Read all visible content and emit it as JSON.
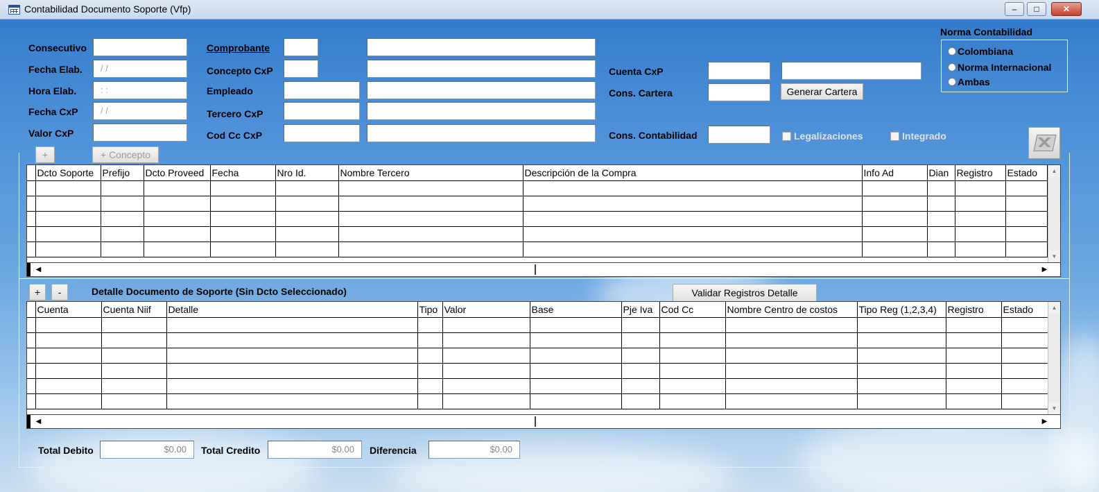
{
  "window": {
    "title": "Contabilidad Documento Soporte (Vfp)",
    "min_label": "–",
    "max_label": "□",
    "close_label": "✕"
  },
  "form": {
    "consecutivo_label": "Consecutivo",
    "fecha_elab_label": "Fecha Elab.",
    "fecha_elab_value": " / /",
    "hora_elab_label": "Hora Elab.",
    "hora_elab_value": " : :",
    "fecha_cxp_label": "Fecha CxP",
    "fecha_cxp_value": " / /",
    "valor_cxp_label": "Valor CxP",
    "comprobante_label": "Comprobante",
    "concepto_cxp_label": "Concepto CxP",
    "empleado_label": "Empleado",
    "tercero_cxp_label": "Tercero CxP",
    "cod_cc_cxp_label": "Cod Cc CxP",
    "cuenta_cxp_label": "Cuenta CxP",
    "cons_cartera_label": "Cons. Cartera",
    "generar_cartera_label": "Generar Cartera",
    "cons_contabilidad_label": "Cons. Contabilidad",
    "legalizaciones_label": "Legalizaciones",
    "integrado_label": "Integrado",
    "add_label": "+",
    "add_concepto_label": "+ Concepto"
  },
  "norma": {
    "title": "Norma Contabilidad",
    "options": [
      "Colombiana",
      "Norma Internacional",
      "Ambas"
    ]
  },
  "grid1": {
    "columns": [
      "Dcto Soporte",
      "Prefijo",
      "Dcto Proveed",
      "Fecha",
      "Nro Id.",
      "Nombre Tercero",
      "Descripción de la Compra",
      "Info Ad",
      "Dian",
      "Registro",
      "Estado"
    ]
  },
  "detail": {
    "add_label": "+",
    "remove_label": "-",
    "title": "Detalle Documento de Soporte (Sin Dcto Seleccionado)",
    "validar_label": "Validar Registros Detalle"
  },
  "grid2": {
    "columns": [
      "Cuenta",
      "Cuenta Niif",
      "Detalle",
      "Tipo",
      "Valor",
      "Base",
      "Pje Iva",
      "Cod Cc",
      "Nombre Centro de costos",
      "Tipo Reg (1,2,3,4)",
      "Registro",
      "Estado"
    ]
  },
  "totals": {
    "debito_label": "Total Debito",
    "debito_value": "$0.00",
    "credito_label": "Total Credito",
    "credito_value": "$0.00",
    "diferencia_label": "Diferencia",
    "diferencia_value": "$0.00"
  }
}
